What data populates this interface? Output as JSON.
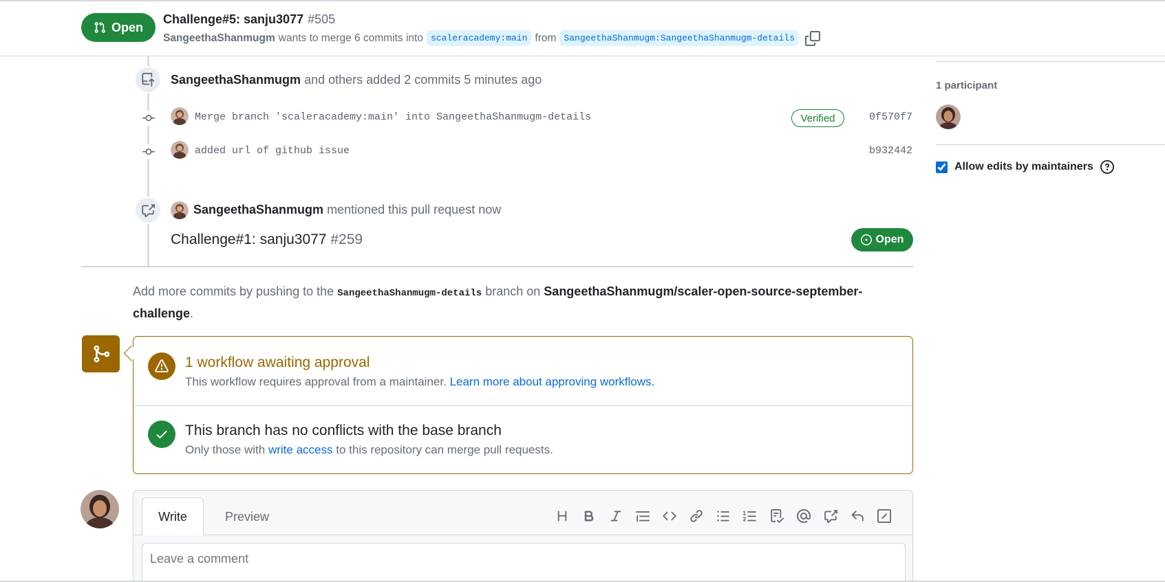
{
  "header": {
    "state": "Open",
    "title": "Challenge#5: sanju3077",
    "number": "#505",
    "author": "SangeethaShanmugm",
    "merge_text": "wants to merge 6 commits into",
    "base_branch": "scaleracademy:main",
    "from_text": "from",
    "head_branch": "SangeethaShanmugm:SangeethaShanmugm-details"
  },
  "timeline": {
    "commits_event": {
      "author": "SangeethaShanmugm",
      "text": "and others added 2 commits 5 minutes ago"
    },
    "commits": [
      {
        "message": "Merge branch 'scaleracademy:main' into SangeethaShanmugm-details",
        "verified": "Verified",
        "sha": "0f570f7"
      },
      {
        "message": "added url of github issue",
        "sha": "b932442"
      }
    ],
    "mention_event": {
      "author": "SangeethaShanmugm",
      "text": "mentioned this pull request now",
      "ref_title": "Challenge#1: sanju3077",
      "ref_number": "#259",
      "ref_state": "Open"
    }
  },
  "push_hint": {
    "prefix": "Add more commits by pushing to the",
    "branch": "SangeethaShanmugm-details",
    "middle": "branch on",
    "repo": "SangeethaShanmugm/scaler-open-source-september-challenge",
    "suffix": "."
  },
  "merge_box": {
    "workflow_title": "1 workflow awaiting approval",
    "workflow_text": "This workflow requires approval from a maintainer.",
    "workflow_link": "Learn more about approving workflows.",
    "conflict_title": "This branch has no conflicts with the base branch",
    "conflict_prefix": "Only those with",
    "conflict_link": "write access",
    "conflict_suffix": "to this repository can merge pull requests."
  },
  "comment": {
    "tab_write": "Write",
    "tab_preview": "Preview",
    "placeholder": "Leave a comment",
    "toolbar": [
      "heading-icon",
      "bold-icon",
      "italic-icon",
      "quote-icon",
      "code-icon",
      "link-icon",
      "unordered-list-icon",
      "ordered-list-icon",
      "task-list-icon",
      "mention-icon",
      "cross-reference-icon",
      "reply-icon",
      "slash-command-icon"
    ]
  },
  "sidebar": {
    "participants_label": "1 participant",
    "allow_edits_label": "Allow edits by maintainers",
    "allow_edits_checked": true
  },
  "colors": {
    "open_green": "#1f883d",
    "attention": "#9a6700",
    "link_blue": "#0969da"
  }
}
